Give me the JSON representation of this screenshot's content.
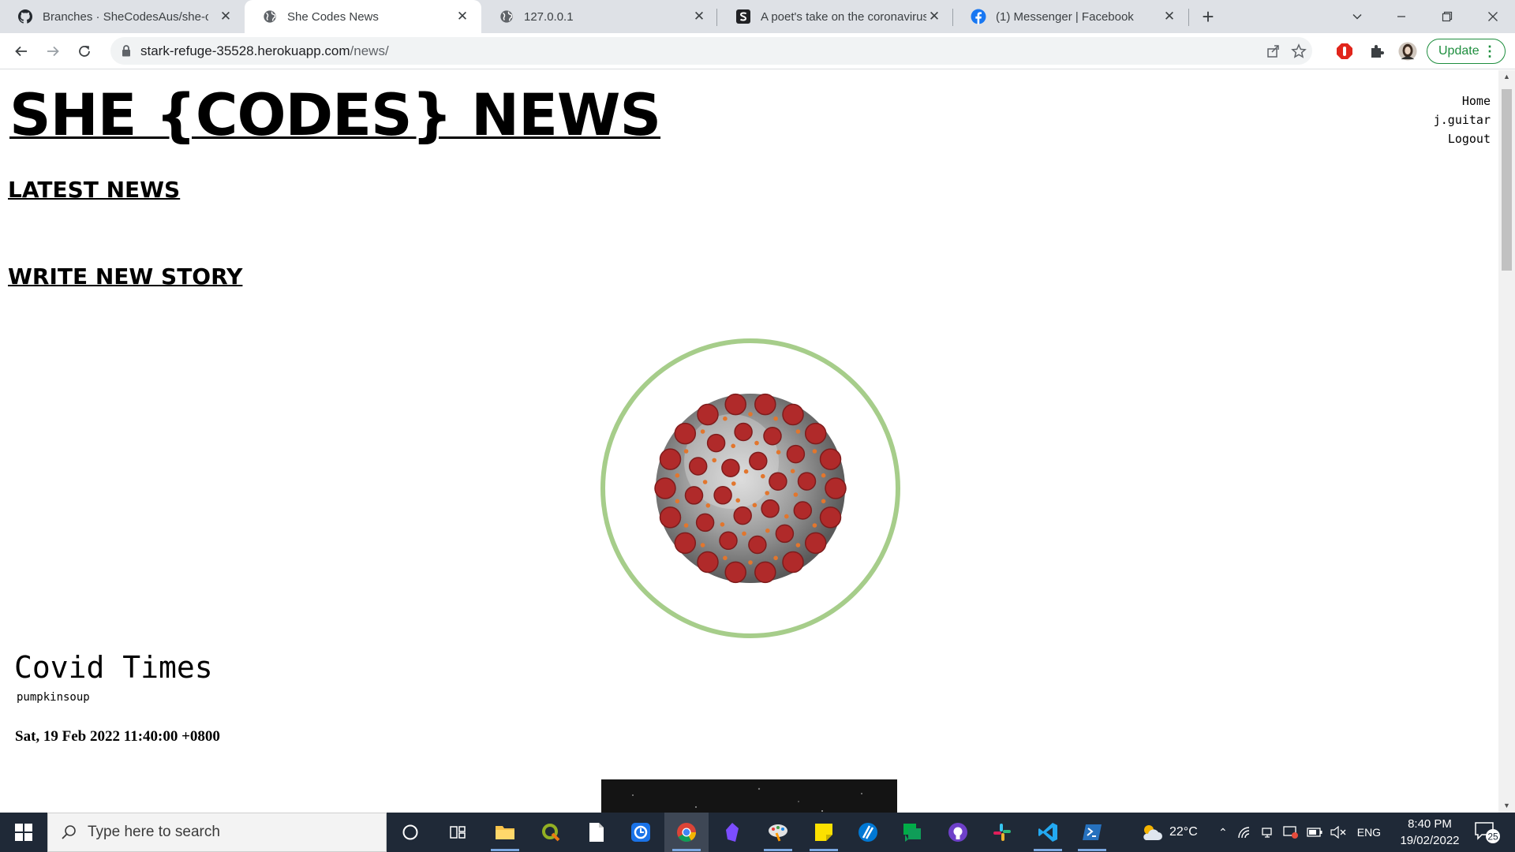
{
  "browser": {
    "tabs": [
      {
        "title": "Branches · SheCodesAus/she-cod",
        "icon": "github-icon",
        "active": false
      },
      {
        "title": "She Codes News",
        "icon": "globe-icon",
        "active": true
      },
      {
        "title": "127.0.0.1",
        "icon": "globe-icon",
        "active": false
      },
      {
        "title": "A poet's take on the coronavirus",
        "icon": "substack-icon",
        "active": false
      },
      {
        "title": "(1) Messenger | Facebook",
        "icon": "facebook-icon",
        "active": false
      }
    ],
    "url_host": "stark-refuge-35528.herokuapp.com",
    "url_path": "/news/",
    "update_label": "Update"
  },
  "page": {
    "site_title": "SHE {CODES} NEWS",
    "nav": {
      "home": "Home",
      "user": "j.guitar",
      "logout": "Logout"
    },
    "latest_news": "LATEST NEWS",
    "write_story": "WRITE NEW STORY",
    "story": {
      "title": "Covid Times",
      "author": "pumpkinsoup",
      "date": "Sat, 19 Feb 2022 11:40:00 +0800",
      "image_icon": "coronavirus-image"
    }
  },
  "taskbar": {
    "search_placeholder": "Type here to search",
    "weather": "22°C",
    "language": "ENG",
    "time": "8:40 PM",
    "date": "19/02/2022",
    "notifications": "25"
  },
  "colors": {
    "tabstrip": "#dee1e6",
    "update_green": "#1e8e3e",
    "image_ring": "#a6cd8a",
    "taskbar": "#1f2937"
  }
}
